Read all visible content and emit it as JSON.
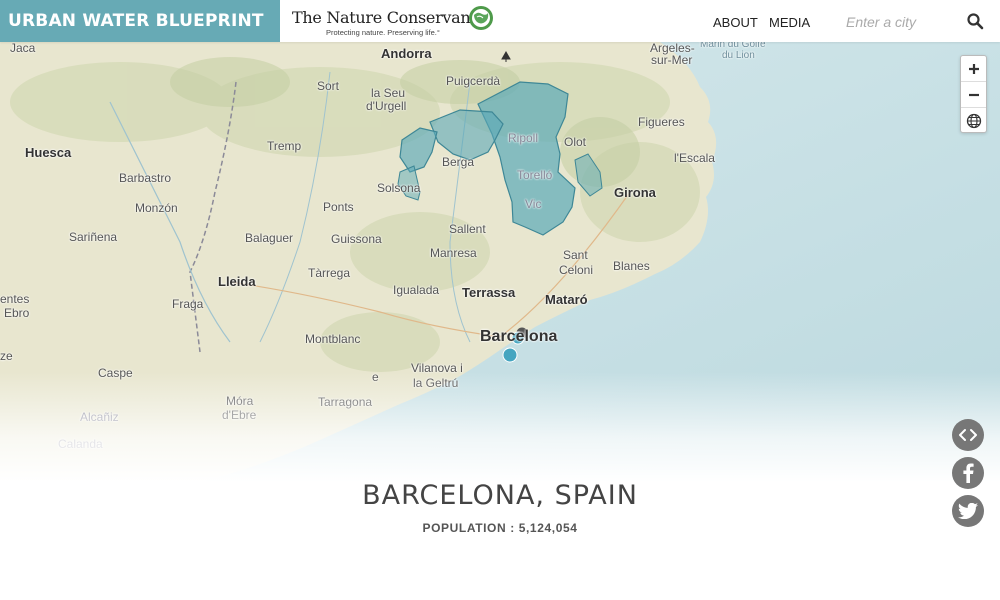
{
  "header": {
    "brand": "URBAN WATER BLUEPRINT",
    "partner_name": "The Nature Conservancy",
    "partner_tagline": "Protecting nature. Preserving life.°",
    "nav": [
      {
        "label": "ABOUT"
      },
      {
        "label": "MEDIA"
      }
    ],
    "search": {
      "placeholder": "Enter a city",
      "value": ""
    }
  },
  "map": {
    "colors": {
      "land": "#e9e8d2",
      "sea": "#c9e1e5",
      "watershed": "#5ba9b8",
      "watershed_stroke": "#3e8796",
      "intake_point": "#45a5c0"
    },
    "labels": {
      "jaca": "Jaca",
      "andorra": "Andorra",
      "puigcerda": "Puigcerdà",
      "argeles1": "Argeles-",
      "argeles2": "sur-Mer",
      "marin1": "Marin du Golfe",
      "marin2": "du Lion",
      "sort": "Sort",
      "laseu1": "la Seu",
      "laseu2": "d'Urgell",
      "ripoll": "Ripoll",
      "figueres": "Figueres",
      "huesca": "Huesca",
      "tremp": "Tremp",
      "olot": "Olot",
      "lescala": "l'Escala",
      "berga": "Berga",
      "torello": "Torelló",
      "barbastro": "Barbastro",
      "girona": "Girona",
      "solsona": "Solsona",
      "monzon": "Monzón",
      "ponts": "Ponts",
      "vic": "Vic",
      "sarinena": "Sariñena",
      "balaguer": "Balaguer",
      "guissona": "Guissona",
      "sallent": "Sallent",
      "manresa": "Manresa",
      "santceloni1": "Sant",
      "santceloni2": "Celoni",
      "blanes": "Blanes",
      "lleida": "Lleida",
      "tarrega": "Tàrrega",
      "fraga": "Fraga",
      "entes": "entes",
      "ebro": "Ebro",
      "igualada": "Igualada",
      "terrassa": "Terrassa",
      "mataro": "Mataró",
      "montblanc": "Montblanc",
      "barcelona": "Barcelona",
      "caspe": "Caspe",
      "e": "e",
      "vilanova1": "Vilanova i",
      "vilanova2": "la Geltrú",
      "ze": "ze",
      "mora1": "Móra",
      "mora2": "d'Ebre",
      "tarragona": "Tarragona",
      "alcaniz": "Alcañiz",
      "calanda": "Calanda"
    },
    "icons": [
      "zoom-in-icon",
      "zoom-out-icon",
      "globe-icon"
    ]
  },
  "share": {
    "icons": [
      "embed-code-icon",
      "facebook-icon",
      "twitter-icon"
    ],
    "color": "#777777"
  },
  "city": {
    "title": "BARCELONA, SPAIN",
    "population": "POPULATION : 5,124,054"
  }
}
